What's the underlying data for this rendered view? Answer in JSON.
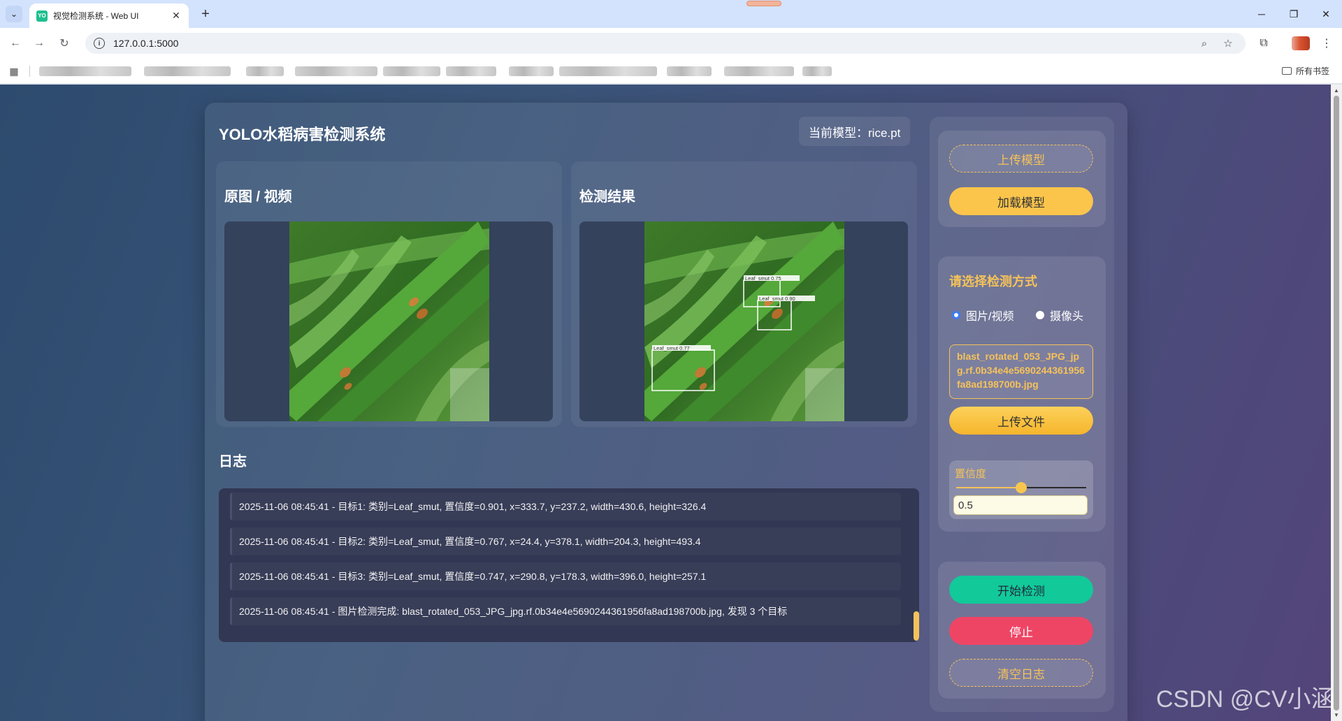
{
  "browser": {
    "tab_title": "视觉检测系统 - Web UI",
    "tab_favicon_text": "YO",
    "new_tab_glyph": "+",
    "url": "127.0.0.1:5000",
    "bookmarks_all_label": "所有书签"
  },
  "app": {
    "title": "YOLO水稻病害检测系统",
    "current_model_label": "当前模型：rice.pt"
  },
  "panels": {
    "original_title": "原图 / 视频",
    "result_title": "检测结果"
  },
  "detections": [
    {
      "label": "Leaf_smut 0.75"
    },
    {
      "label": "Leaf_smut 0.90"
    },
    {
      "label": "Leaf_smut 0.77"
    }
  ],
  "log": {
    "title": "日志",
    "entries": [
      "2025-11-06 08:45:41 - 目标1: 类别=Leaf_smut, 置信度=0.901, x=333.7, y=237.2, width=430.6, height=326.4",
      "2025-11-06 08:45:41 - 目标2: 类别=Leaf_smut, 置信度=0.767, x=24.4, y=378.1, width=204.3, height=493.4",
      "2025-11-06 08:45:41 - 目标3: 类别=Leaf_smut, 置信度=0.747, x=290.8, y=178.3, width=396.0, height=257.1",
      "2025-11-06 08:45:41 - 图片检测完成: blast_rotated_053_JPG_jpg.rf.0b34e4e5690244361956fa8ad198700b.jpg, 发现 3 个目标"
    ]
  },
  "sidebar": {
    "upload_model": "上传模型",
    "load_model": "加载模型",
    "mode_title": "请选择检测方式",
    "mode_image": "图片/视频",
    "mode_camera": "摄像头",
    "selected_mode": "图片/视频",
    "file_name": "blast_rotated_053_JPG_jpg.rf.0b34e4e5690244361956fa8ad198700b.jpg",
    "upload_file": "上传文件",
    "confidence_label": "置信度",
    "confidence_value": "0.5",
    "confidence_fraction": 0.5,
    "start_detect": "开始检测",
    "stop": "停止",
    "clear_log": "清空日志"
  },
  "watermark": "CSDN @CV小涵",
  "colors": {
    "accent_yellow": "#f5c25a",
    "start_green": "#12c99a",
    "stop_red": "#ef4565",
    "radio_blue": "#3d7df5"
  }
}
